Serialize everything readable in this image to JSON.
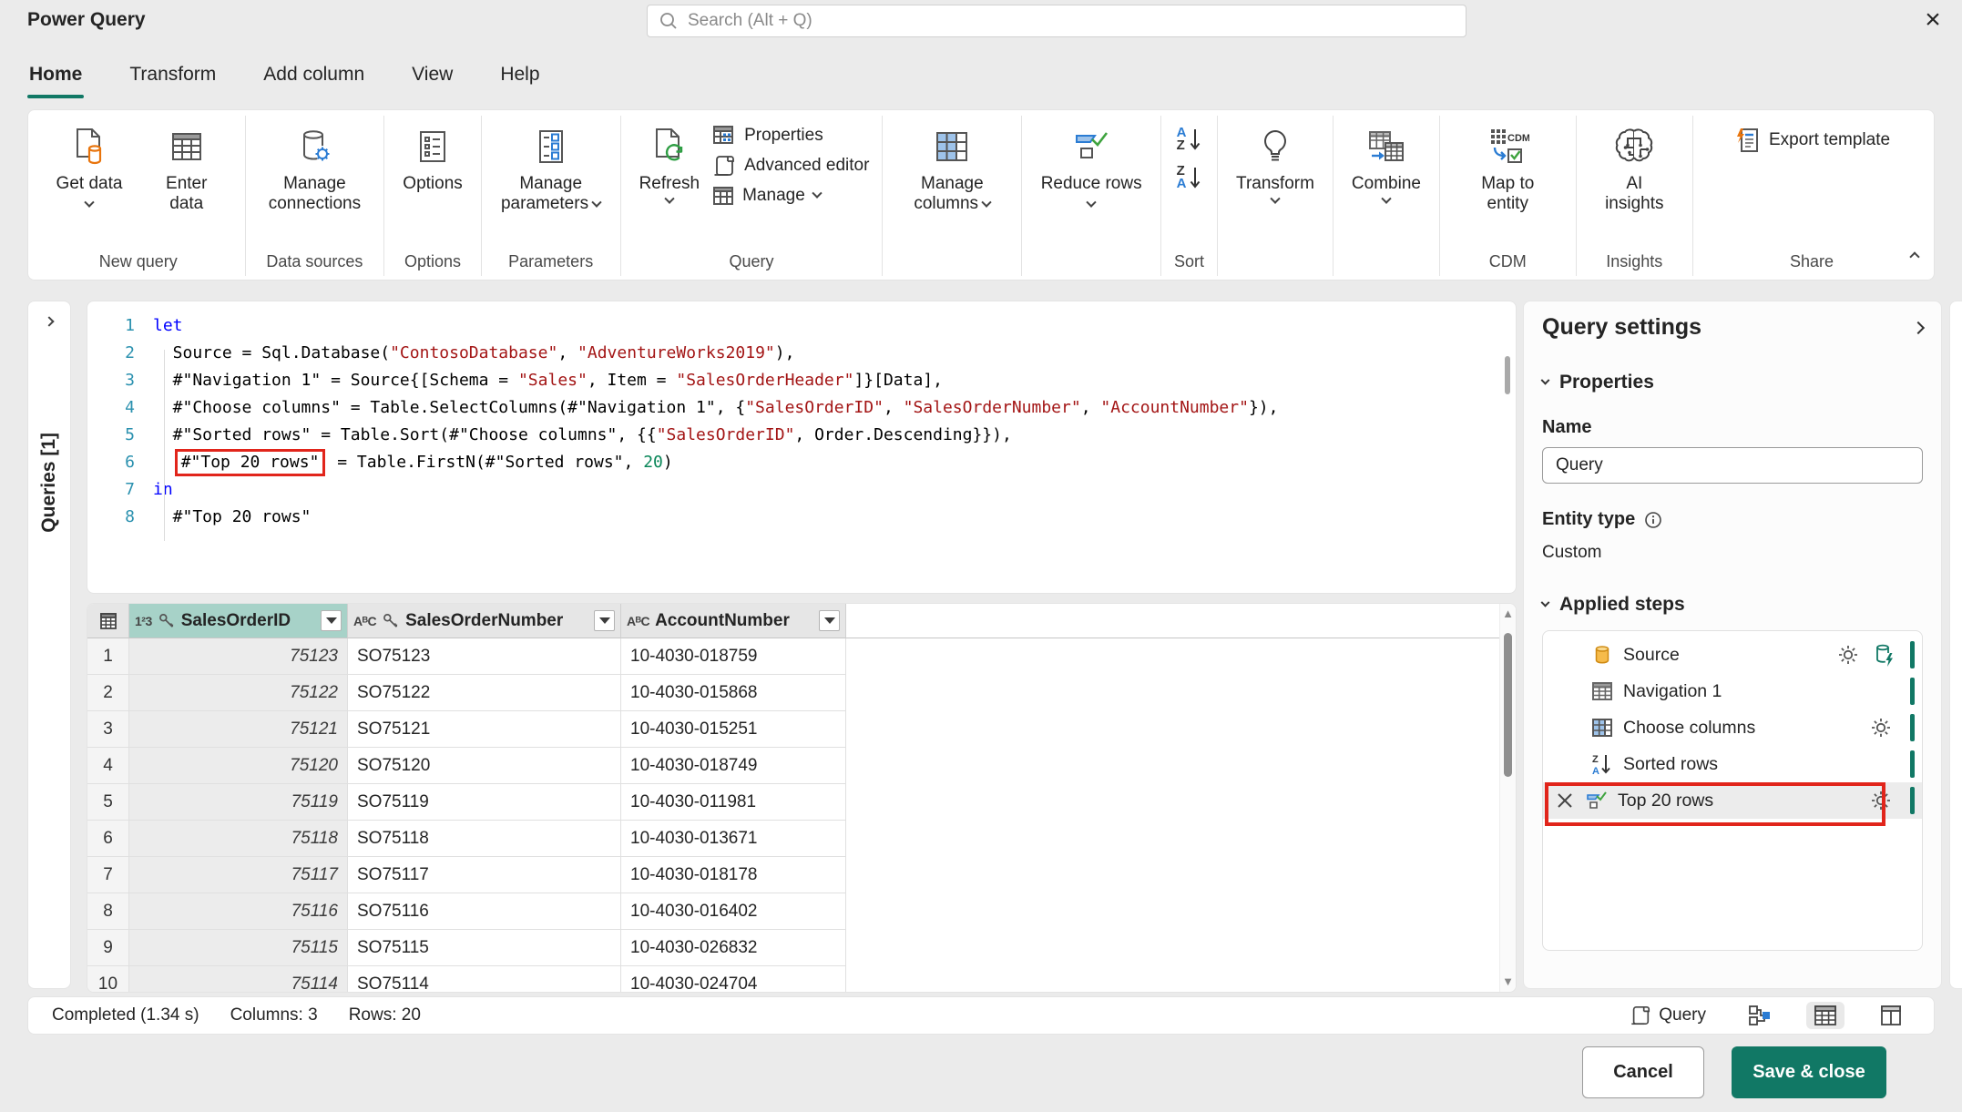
{
  "window": {
    "title": "Power Query",
    "close_glyph": "×"
  },
  "search": {
    "placeholder": "Search (Alt + Q)"
  },
  "tabs": [
    {
      "label": "Home",
      "active": true
    },
    {
      "label": "Transform",
      "active": false
    },
    {
      "label": "Add column",
      "active": false
    },
    {
      "label": "View",
      "active": false
    },
    {
      "label": "Help",
      "active": false
    }
  ],
  "ribbon": {
    "get_data": "Get data",
    "enter_data": "Enter data",
    "manage_connections": "Manage connections",
    "options": "Options",
    "manage_parameters": "Manage parameters",
    "refresh": "Refresh",
    "properties": "Properties",
    "advanced_editor": "Advanced editor",
    "manage": "Manage",
    "manage_columns": "Manage columns",
    "reduce_rows": "Reduce rows",
    "transform": "Transform",
    "combine": "Combine",
    "map_to_entity": "Map to entity",
    "ai_insights": "AI insights",
    "export_template": "Export template",
    "group_labels": {
      "new_query": "New query",
      "data_sources": "Data sources",
      "options": "Options",
      "parameters": "Parameters",
      "query": "Query",
      "sort": "Sort",
      "cdm": "CDM",
      "insights": "Insights",
      "share": "Share"
    }
  },
  "queries_pane": {
    "label": "Queries [1]"
  },
  "editor": {
    "lines": [
      {
        "n": "1",
        "segs": [
          {
            "c": "kw",
            "t": "let"
          }
        ]
      },
      {
        "n": "2",
        "segs": [
          {
            "c": "pl",
            "t": "  Source = Sql.Database("
          },
          {
            "c": "str",
            "t": "\"ContosoDatabase\""
          },
          {
            "c": "pl",
            "t": ", "
          },
          {
            "c": "str",
            "t": "\"AdventureWorks2019\""
          },
          {
            "c": "pl",
            "t": "),"
          }
        ]
      },
      {
        "n": "3",
        "segs": [
          {
            "c": "pl",
            "t": "  #\"Navigation 1\" = Source{[Schema = "
          },
          {
            "c": "str",
            "t": "\"Sales\""
          },
          {
            "c": "pl",
            "t": ", Item = "
          },
          {
            "c": "str",
            "t": "\"SalesOrderHeader\""
          },
          {
            "c": "pl",
            "t": "]}[Data],"
          }
        ]
      },
      {
        "n": "4",
        "segs": [
          {
            "c": "pl",
            "t": "  #\"Choose columns\" = Table.SelectColumns(#\"Navigation 1\", {"
          },
          {
            "c": "str",
            "t": "\"SalesOrderID\""
          },
          {
            "c": "pl",
            "t": ", "
          },
          {
            "c": "str",
            "t": "\"SalesOrderNumber\""
          },
          {
            "c": "pl",
            "t": ", "
          },
          {
            "c": "str",
            "t": "\"AccountNumber\""
          },
          {
            "c": "pl",
            "t": "}),"
          }
        ]
      },
      {
        "n": "5",
        "segs": [
          {
            "c": "pl",
            "t": "  #\"Sorted rows\" = Table.Sort(#\"Choose columns\", {{"
          },
          {
            "c": "str",
            "t": "\"SalesOrderID\""
          },
          {
            "c": "pl",
            "t": ", Order.Descending}}),"
          }
        ]
      },
      {
        "n": "6",
        "segs": [
          {
            "c": "pl",
            "t": "  "
          },
          {
            "c": "box",
            "t": "#\"Top 20 rows\""
          },
          {
            "c": "pl",
            "t": " = Table.FirstN(#\"Sorted rows\", "
          },
          {
            "c": "num",
            "t": "20"
          },
          {
            "c": "pl",
            "t": ")"
          }
        ]
      },
      {
        "n": "7",
        "segs": [
          {
            "c": "kw",
            "t": "in"
          }
        ]
      },
      {
        "n": "8",
        "segs": [
          {
            "c": "pl",
            "t": "  #\"Top 20 rows\""
          }
        ]
      }
    ]
  },
  "grid": {
    "columns": [
      {
        "type": "123",
        "key": true,
        "name": "SalesOrderID",
        "selected": true
      },
      {
        "type": "ABC",
        "key": true,
        "name": "SalesOrderNumber",
        "selected": false
      },
      {
        "type": "ABC",
        "key": false,
        "name": "AccountNumber",
        "selected": false
      }
    ],
    "rows": [
      [
        "75123",
        "SO75123",
        "10-4030-018759"
      ],
      [
        "75122",
        "SO75122",
        "10-4030-015868"
      ],
      [
        "75121",
        "SO75121",
        "10-4030-015251"
      ],
      [
        "75120",
        "SO75120",
        "10-4030-018749"
      ],
      [
        "75119",
        "SO75119",
        "10-4030-011981"
      ],
      [
        "75118",
        "SO75118",
        "10-4030-013671"
      ],
      [
        "75117",
        "SO75117",
        "10-4030-018178"
      ],
      [
        "75116",
        "SO75116",
        "10-4030-016402"
      ],
      [
        "75115",
        "SO75115",
        "10-4030-026832"
      ],
      [
        "75114",
        "SO75114",
        "10-4030-024704"
      ]
    ]
  },
  "settings": {
    "title": "Query settings",
    "properties_label": "Properties",
    "name_label": "Name",
    "name_value": "Query",
    "entity_type_label": "Entity type",
    "entity_type_value": "Custom",
    "applied_steps_label": "Applied steps",
    "steps": [
      {
        "label": "Source",
        "icon": "database",
        "gear": true,
        "native_query": true,
        "selected": false,
        "removable": false
      },
      {
        "label": "Navigation 1",
        "icon": "table",
        "gear": false,
        "native_query": false,
        "selected": false,
        "removable": false
      },
      {
        "label": "Choose columns",
        "icon": "table-columns",
        "gear": true,
        "native_query": false,
        "selected": false,
        "removable": false
      },
      {
        "label": "Sorted rows",
        "icon": "sort-desc",
        "gear": false,
        "native_query": false,
        "selected": false,
        "removable": false
      },
      {
        "label": "Top 20 rows",
        "icon": "keep-rows",
        "gear": true,
        "native_query": false,
        "selected": true,
        "removable": true
      }
    ]
  },
  "statusbar": {
    "completed": "Completed (1.34 s)",
    "columns": "Columns: 3",
    "rows": "Rows: 20",
    "query_view_label": "Query"
  },
  "footer": {
    "cancel": "Cancel",
    "save": "Save & close"
  },
  "colors": {
    "accent_teal": "#117865",
    "highlight_red": "#e1251b",
    "code_string": "#a31515",
    "code_keyword": "#0000ff",
    "code_number": "#098658",
    "selected_header": "#a7d2c8"
  }
}
